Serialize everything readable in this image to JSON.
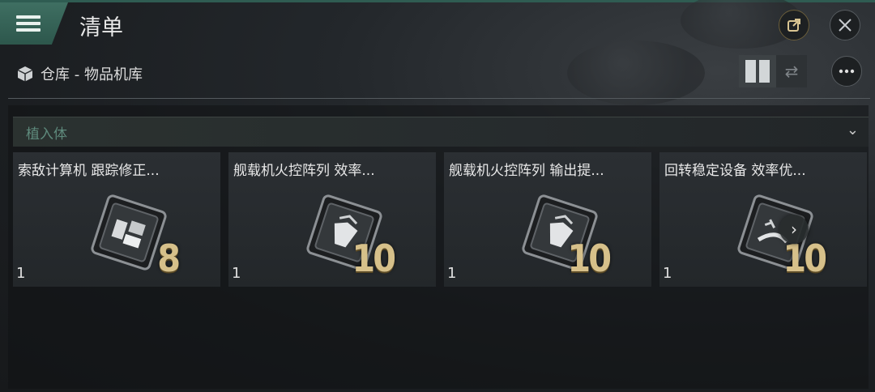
{
  "header": {
    "title": "清单",
    "menu_icon": "hamburger-menu-icon",
    "share_icon": "share-icon",
    "close_icon": "close-icon"
  },
  "breadcrumb": {
    "icon": "cube-icon",
    "text": "仓库 - 物品机库"
  },
  "toolbar": {
    "grid_view_icon": "grid-view-icon",
    "list_view_icon": "swap-view-icon",
    "more_icon": "more-icon"
  },
  "section": {
    "label": "植入体",
    "expand_icon": "chevron-down-icon"
  },
  "items": [
    {
      "name": "索敌计算机 跟踪修正...",
      "quantity": "1",
      "level": "8",
      "icon": "targeting-chip-icon"
    },
    {
      "name": "舰载机火控阵列 效率...",
      "quantity": "1",
      "level": "10",
      "icon": "fighter-chip-icon"
    },
    {
      "name": "舰载机火控阵列 输出提...",
      "quantity": "1",
      "level": "10",
      "icon": "fighter-chip-icon"
    },
    {
      "name": "回转稳定设备 效率优...",
      "quantity": "1",
      "level": "10",
      "icon": "stabilizer-chip-icon"
    }
  ],
  "next_icon": "chevron-right-icon",
  "colors": {
    "accent": "#3f6f62",
    "section_label": "#5e8a7c",
    "level_gold": "#d6c08a"
  }
}
